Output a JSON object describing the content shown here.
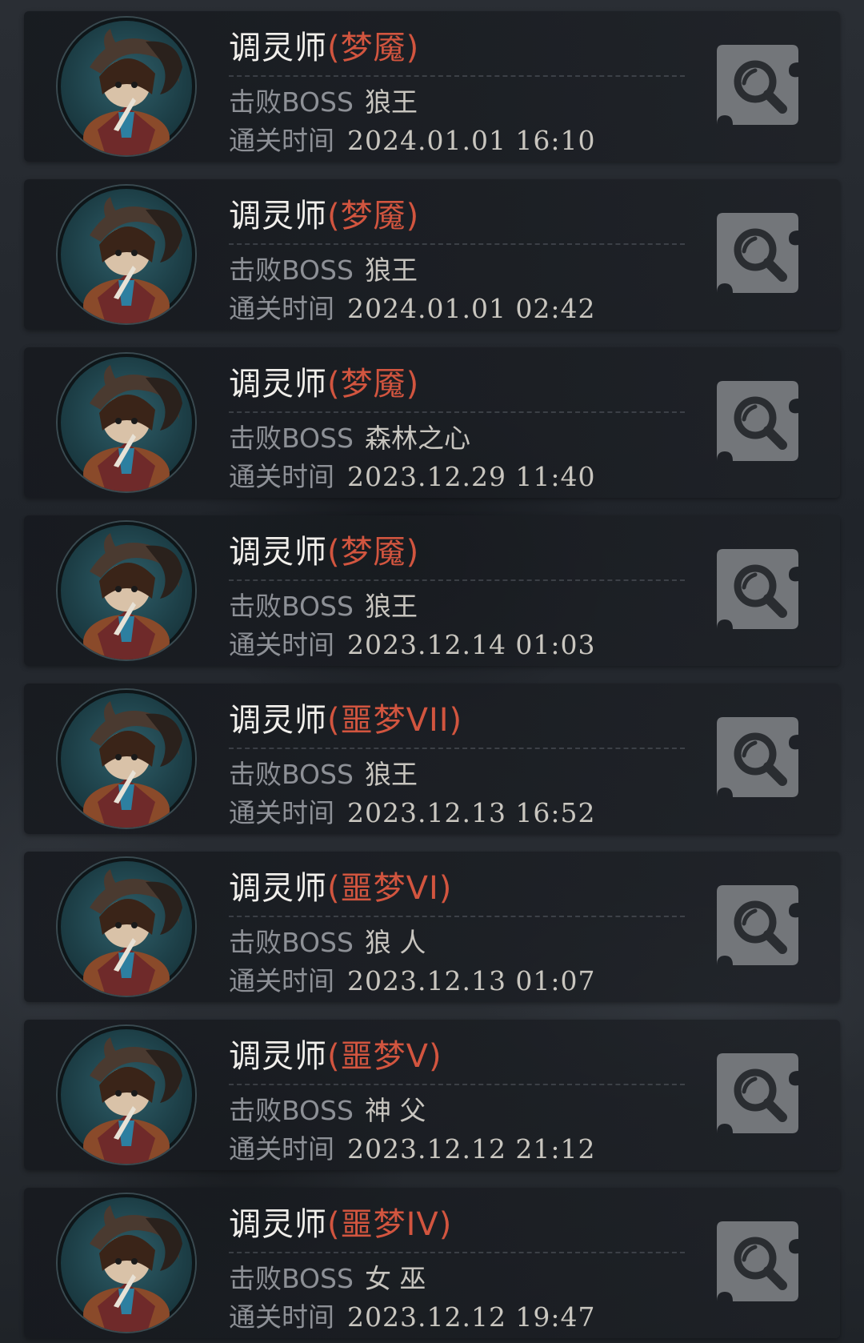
{
  "labels": {
    "boss_prefix": "击败BOSS",
    "time_prefix": "通关时间"
  },
  "records": [
    {
      "character": "调灵师",
      "difficulty": "(梦魇)",
      "boss": "狼王",
      "time": "2024.01.01 16:10"
    },
    {
      "character": "调灵师",
      "difficulty": "(梦魇)",
      "boss": "狼王",
      "time": "2024.01.01 02:42"
    },
    {
      "character": "调灵师",
      "difficulty": "(梦魇)",
      "boss": "森林之心",
      "time": "2023.12.29 11:40"
    },
    {
      "character": "调灵师",
      "difficulty": "(梦魇)",
      "boss": "狼王",
      "time": "2023.12.14 01:03"
    },
    {
      "character": "调灵师",
      "difficulty": "(噩梦VII)",
      "boss": "狼王",
      "time": "2023.12.13 16:52"
    },
    {
      "character": "调灵师",
      "difficulty": "(噩梦VI)",
      "boss": "狼 人",
      "time": "2023.12.13 01:07"
    },
    {
      "character": "调灵师",
      "difficulty": "(噩梦V)",
      "boss": "神 父",
      "time": "2023.12.12 21:12"
    },
    {
      "character": "调灵师",
      "difficulty": "(噩梦IV)",
      "boss": "女 巫",
      "time": "2023.12.12 19:47"
    }
  ],
  "colors": {
    "difficulty": "#d2553f",
    "title": "#f1efeb",
    "label": "#8d9096",
    "value": "#c7c4be"
  },
  "icons": {
    "avatar": "character-portrait-icon",
    "view": "magnifier-icon"
  }
}
